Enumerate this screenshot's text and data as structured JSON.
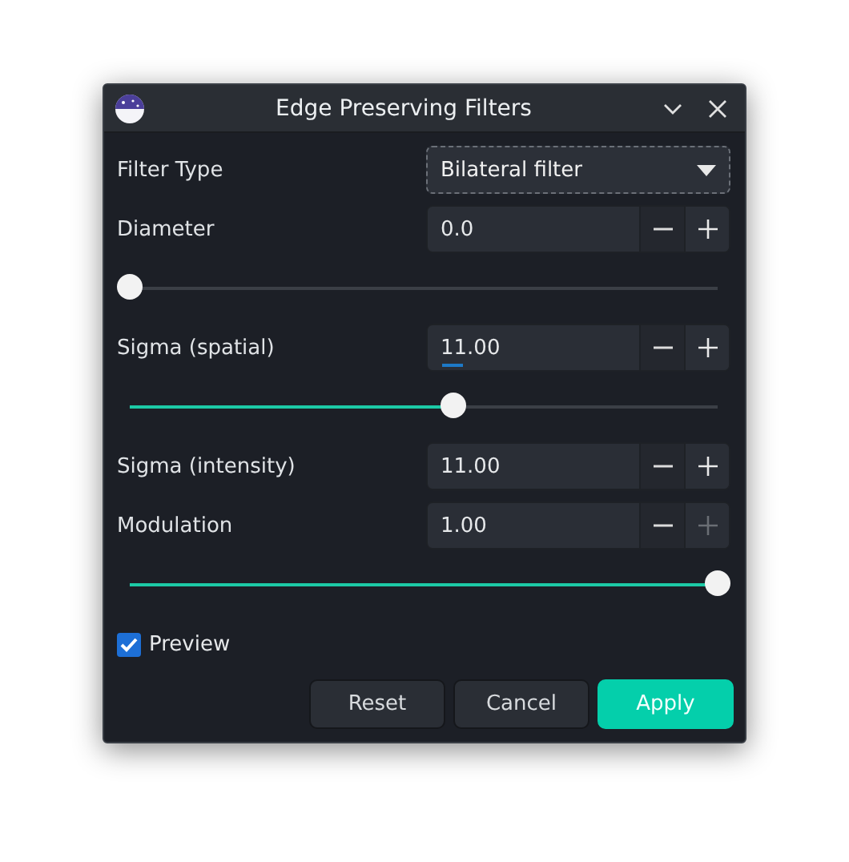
{
  "window": {
    "title": "Edge Preserving Filters"
  },
  "rows": [
    {
      "kind": "dropdown",
      "label": "Filter Type",
      "value": "Bilateral filter",
      "focused": true
    },
    {
      "kind": "spin",
      "label": "Diameter",
      "value": "0.0",
      "focused": false,
      "increment_disabled": false
    },
    {
      "kind": "slider",
      "level": 0
    },
    {
      "kind": "spin",
      "label": "Sigma (spatial)",
      "value": "11.00",
      "focused": true,
      "increment_disabled": false
    },
    {
      "kind": "slider",
      "level": 0.55
    },
    {
      "kind": "spin",
      "label": "Sigma (intensity)",
      "value": "11.00",
      "focused": false,
      "increment_disabled": false
    },
    {
      "kind": "spin",
      "label": "Modulation",
      "value": "1.00",
      "focused": false,
      "increment_disabled": true
    },
    {
      "kind": "slider",
      "level": 1
    },
    {
      "kind": "checkbox",
      "label": "Preview",
      "checked": true
    }
  ],
  "buttons": [
    {
      "label": "Reset",
      "primary": false
    },
    {
      "label": "Cancel",
      "primary": false
    },
    {
      "label": "Apply",
      "primary": true
    }
  ]
}
